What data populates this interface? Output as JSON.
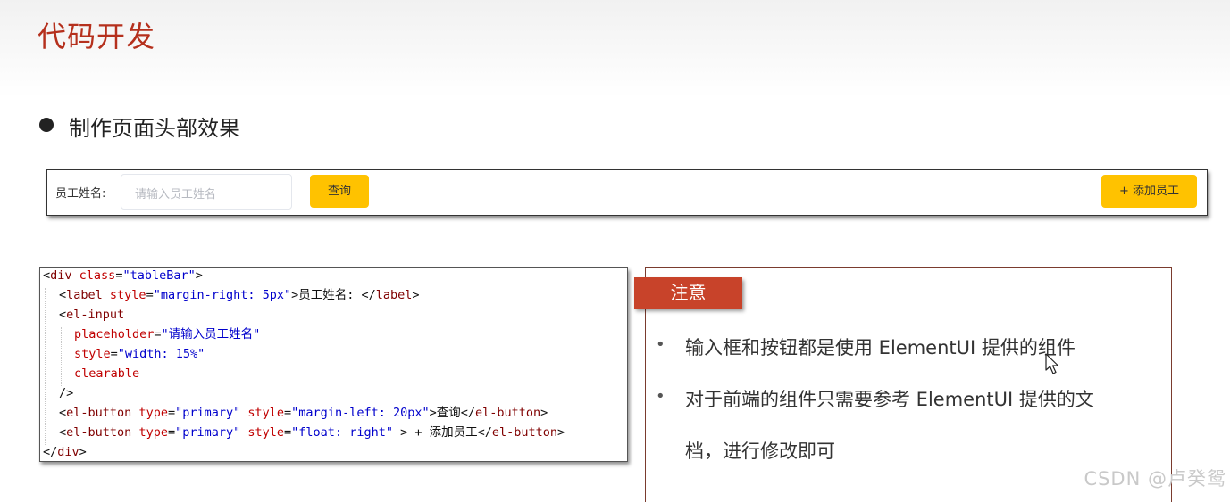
{
  "slide": {
    "title": "代码开发",
    "heading": "制作页面头部效果"
  },
  "demo": {
    "label": "员工姓名:",
    "input_placeholder": "请输入员工姓名",
    "search_button": "查询",
    "add_button": "+ 添加员工",
    "button_color": "#ffc200"
  },
  "code": {
    "line1": {
      "p1": "<",
      "tag": "div",
      "sp": " ",
      "attr": "class",
      "eq": "=",
      "val": "\"tableBar\"",
      "end": ">"
    },
    "line2": {
      "p1": "<",
      "tag": "label",
      "sp": " ",
      "attr": "style",
      "eq": "=",
      "val": "\"margin-right: 5px\"",
      "text": ">员工姓名: </",
      "tag2": "label",
      "end": ">"
    },
    "line3": {
      "p1": "<",
      "tag": "el-input"
    },
    "line4": {
      "attr": "placeholder",
      "eq": "=",
      "val": "\"请输入员工姓名\""
    },
    "line5": {
      "attr": "style",
      "eq": "=",
      "val": "\"width: 15%\""
    },
    "line6": {
      "attr": "clearable"
    },
    "line7": {
      "text": "/>"
    },
    "line8": {
      "p1": "<",
      "tag": "el-button",
      "sp": " ",
      "attr1": "type",
      "eq1": "=",
      "val1": "\"primary\"",
      "sp2": " ",
      "attr2": "style",
      "eq2": "=",
      "val2": "\"margin-left: 20px\"",
      "text": ">查询</",
      "tag2": "el-button",
      "end": ">"
    },
    "line9": {
      "p1": "<",
      "tag": "el-button",
      "sp": " ",
      "attr1": "type",
      "eq1": "=",
      "val1": "\"primary\"",
      "sp2": " ",
      "attr2": "style",
      "eq2": "=",
      "val2": "\"float: right\"",
      "text": " > + 添加员工</",
      "tag2": "el-button",
      "end": ">"
    },
    "line10": {
      "p1": "</",
      "tag": "div",
      "end": ">"
    }
  },
  "note": {
    "tag": "注意",
    "bullet": "•",
    "items": [
      "输入框和按钮都是使用 ElementUI 提供的组件",
      "对于前端的组件只需要参考 ElementUI 提供的文",
      "档，进行修改即可"
    ]
  },
  "watermark": "CSDN @卢癸鸳",
  "colors": {
    "title": "#b5301d",
    "note_tag": "#c8432a"
  }
}
